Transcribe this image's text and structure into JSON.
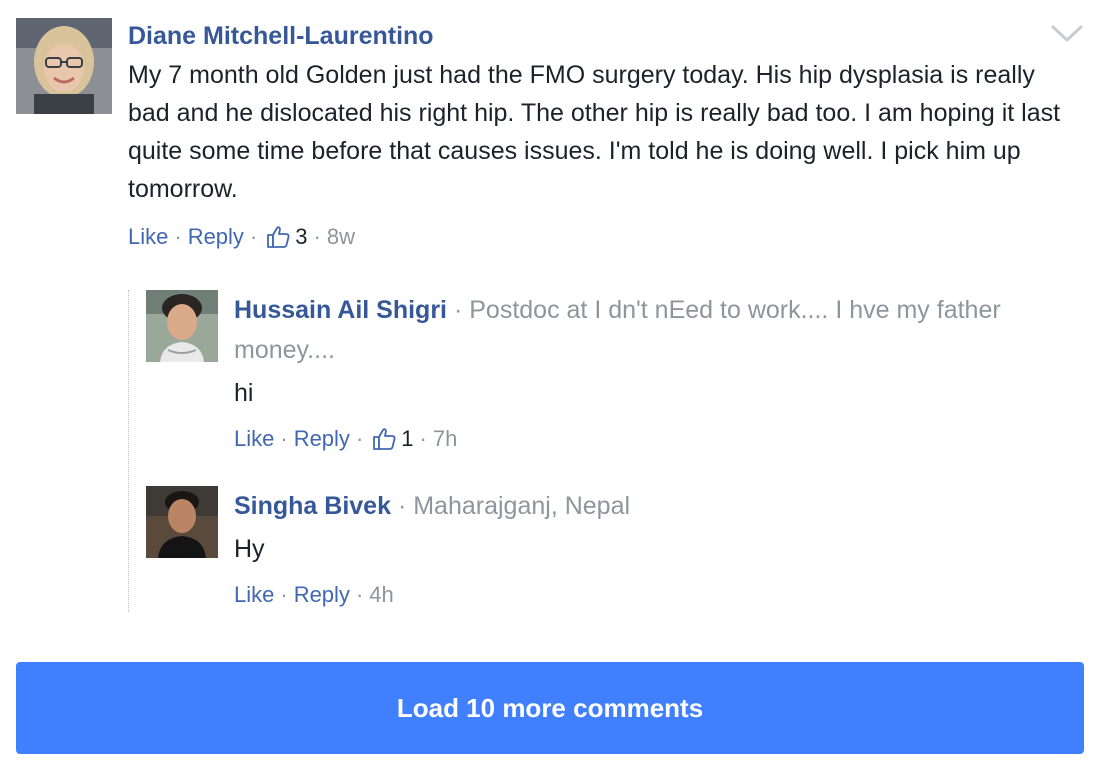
{
  "main_comment": {
    "author": "Diane Mitchell-Laurentino",
    "text": "My 7 month old Golden just had the FMO surgery today. His hip dysplasia is really bad and he dislocated his right hip. The other hip is really bad too. I am hoping it last quite some time before that causes issues. I'm told he is doing well. I pick him up tomorrow.",
    "like_label": "Like",
    "reply_label": "Reply",
    "like_count": "3",
    "time": "8w",
    "menu_icon": "chevron-down-icon"
  },
  "replies": [
    {
      "author": "Hussain Ail Shigri",
      "subtitle": "Postdoc at I dn't nEed to work.... I hve my father money....",
      "text": "hi",
      "like_label": "Like",
      "reply_label": "Reply",
      "like_count": "1",
      "time": "7h"
    },
    {
      "author": "Singha Bivek",
      "subtitle": "Maharajganj, Nepal",
      "text": "Hy",
      "like_label": "Like",
      "reply_label": "Reply",
      "time": "4h"
    }
  ],
  "load_more": {
    "label": "Load 10 more comments"
  },
  "colors": {
    "author_link": "#365899",
    "action_link": "#4267b2",
    "meta_gray": "#90949c",
    "button_blue": "#4080ff"
  }
}
